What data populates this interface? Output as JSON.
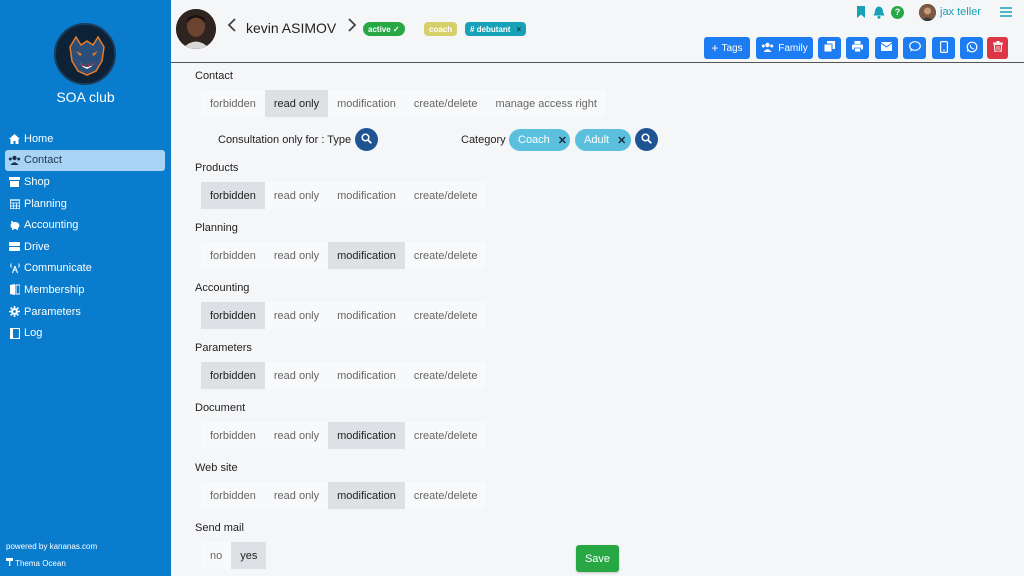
{
  "sidebar": {
    "club_name": "SOA club",
    "items": [
      {
        "label": "Home",
        "icon": "home-icon"
      },
      {
        "label": "Contact",
        "icon": "users-icon",
        "active": true
      },
      {
        "label": "Shop",
        "icon": "shop-icon"
      },
      {
        "label": "Planning",
        "icon": "calendar-icon"
      },
      {
        "label": "Accounting",
        "icon": "piggy-bank-icon"
      },
      {
        "label": "Drive",
        "icon": "drive-icon"
      },
      {
        "label": "Communicate",
        "icon": "broadcast-icon"
      },
      {
        "label": "Membership",
        "icon": "id-card-icon"
      },
      {
        "label": "Parameters",
        "icon": "gear-icon"
      },
      {
        "label": "Log",
        "icon": "log-icon"
      }
    ],
    "powered": "powered by kananas.com",
    "theme": "Thema Ocean"
  },
  "header": {
    "name": "kevin ASIMOV",
    "status_badge": "active ✓",
    "role_badge": "coach",
    "tag_badge": "# debutant",
    "tag_remove": "×",
    "user_name": "jax teller",
    "help": "?",
    "actions": {
      "tags": "Tags",
      "family": "Family"
    }
  },
  "colors": {
    "sidebar": "#0a7ccd",
    "accent": "#1d7cf2",
    "active_badge": "#28a745",
    "coach_badge": "#d6cf6a",
    "tag_badge": "#17a2b8",
    "danger": "#dc3545",
    "chip": "#5bc0de"
  },
  "contact": {
    "label": "Contact",
    "options": [
      "forbidden",
      "read only",
      "modification",
      "create/delete",
      "manage access right"
    ],
    "selected": "read only",
    "consultation": "Consultation only for : Type",
    "category_label": "Category",
    "chips": [
      "Coach",
      "Adult"
    ]
  },
  "sections": [
    {
      "label": "Products",
      "selected": "forbidden"
    },
    {
      "label": "Planning",
      "selected": "modification"
    },
    {
      "label": "Accounting",
      "selected": "forbidden"
    },
    {
      "label": "Parameters",
      "selected": "forbidden"
    },
    {
      "label": "Document",
      "selected": "modification"
    },
    {
      "label": "Web site",
      "selected": "modification"
    }
  ],
  "common_options": [
    "forbidden",
    "read only",
    "modification",
    "create/delete"
  ],
  "send_mail": {
    "label": "Send mail",
    "options": [
      "no",
      "yes"
    ],
    "selected": "yes"
  },
  "save_label": "Save"
}
